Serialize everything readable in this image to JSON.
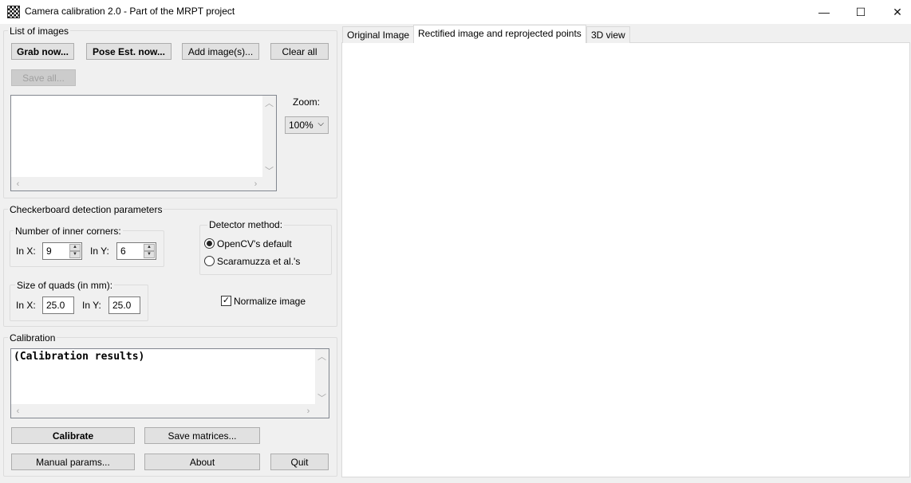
{
  "window": {
    "title": "Camera calibration 2.0 - Part of the MRPT project",
    "minimize_glyph": "—",
    "maximize_glyph": "☐",
    "close_glyph": "✕"
  },
  "images_group": {
    "title": "List of images",
    "grab_now": "Grab now...",
    "pose_est_now": "Pose Est. now...",
    "add_images": "Add image(s)...",
    "clear_all": "Clear all",
    "save_all": "Save all...",
    "zoom_label": "Zoom:",
    "zoom_value": "100%"
  },
  "checkerboard_group": {
    "title": "Checkerboard detection parameters",
    "inner_corners_title": "Number of inner corners:",
    "in_x_label": "In X:",
    "in_x_value": "9",
    "in_y_label": "In Y:",
    "in_y_value": "6",
    "quad_size_title": "Size of quads (in mm):",
    "quad_x_label": "In X:",
    "quad_x_value": "25.0",
    "quad_y_label": "In Y:",
    "quad_y_value": "25.0",
    "detector_title": "Detector method:",
    "detector_options": [
      "OpenCV's default",
      "Scaramuzza et al.'s"
    ],
    "detector_selected": "OpenCV's default",
    "normalize_label": "Normalize image",
    "normalize_checked": true
  },
  "calibration_group": {
    "title": "Calibration",
    "results_text": "(Calibration results)",
    "calibrate": "Calibrate",
    "save_matrices": "Save matrices...",
    "manual_params": "Manual params...",
    "about": "About",
    "quit": "Quit"
  },
  "tabs": [
    "Original Image",
    "Rectified image and reprojected points",
    "3D view"
  ],
  "active_tab": "Rectified image and reprojected points"
}
